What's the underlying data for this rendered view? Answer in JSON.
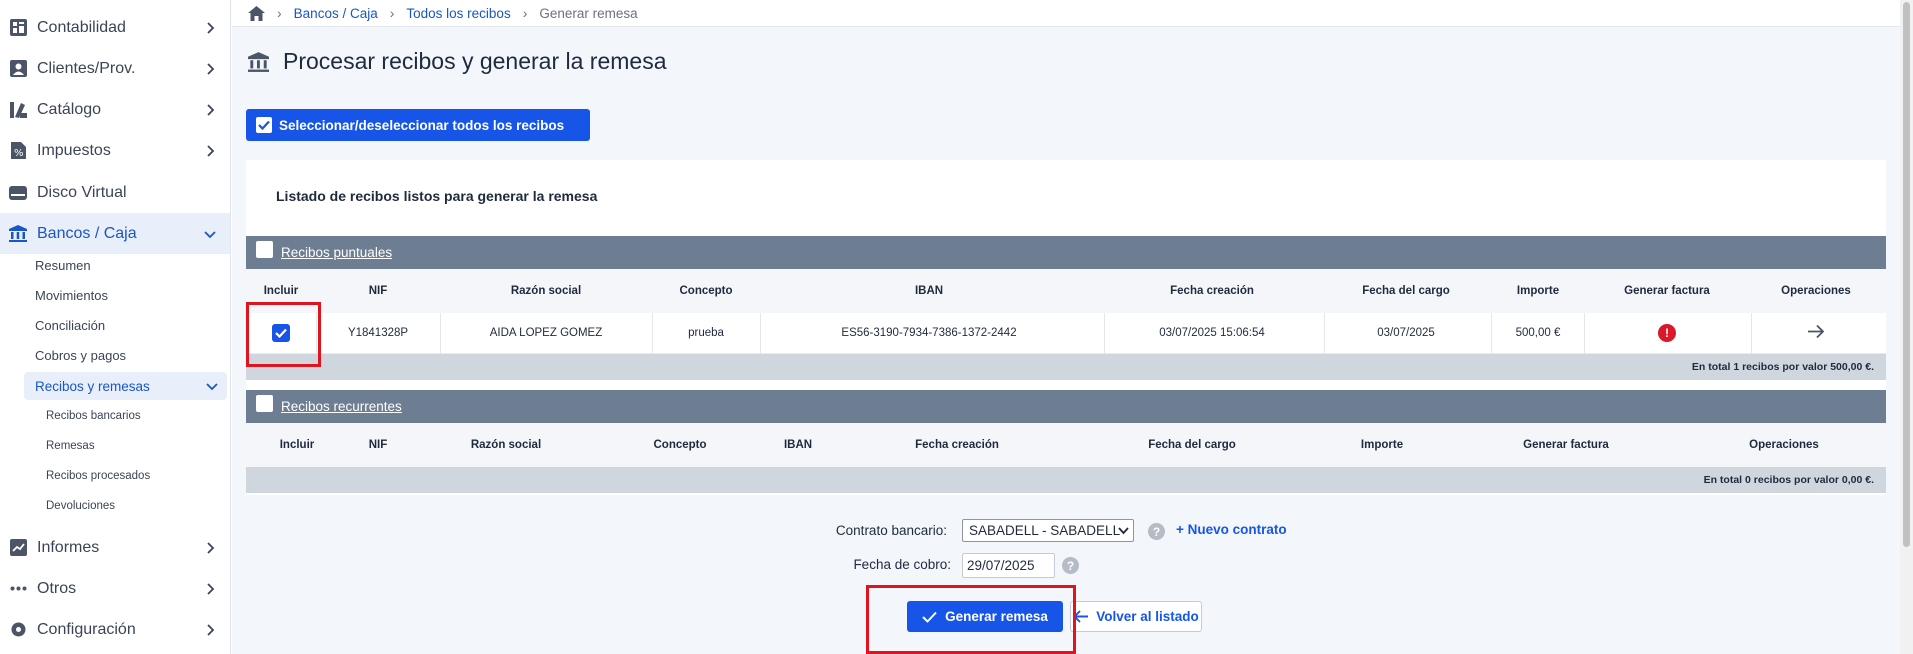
{
  "sidebar": {
    "items": [
      {
        "label": "Contabilidad",
        "icon": "dashboard-icon"
      },
      {
        "label": "Clientes/Prov.",
        "icon": "person-card-icon"
      },
      {
        "label": "Catálogo",
        "icon": "catalog-icon"
      },
      {
        "label": "Impuestos",
        "icon": "tax-icon"
      },
      {
        "label": "Disco Virtual",
        "icon": "disk-icon"
      },
      {
        "label": "Bancos / Caja",
        "icon": "bank-icon"
      },
      {
        "label": "Informes",
        "icon": "report-icon"
      },
      {
        "label": "Otros",
        "icon": "dots-icon"
      },
      {
        "label": "Configuración",
        "icon": "gear-icon"
      }
    ],
    "subitems": [
      "Resumen",
      "Movimientos",
      "Conciliación",
      "Cobros y pagos",
      "Recibos y remesas"
    ],
    "subsubitems": [
      "Recibos bancarios",
      "Remesas",
      "Recibos procesados",
      "Devoluciones"
    ]
  },
  "breadcrumb": {
    "home_icon": "home-icon",
    "items": [
      "Bancos / Caja",
      "Todos los recibos",
      "Generar remesa"
    ]
  },
  "page": {
    "title": "Procesar recibos y generar la remesa",
    "select_all_label": "Seleccionar/deseleccionar todos los recibos"
  },
  "card": {
    "title": "Listado de recibos listos para generar la remesa"
  },
  "puntuales": {
    "section_label": "Recibos puntuales",
    "columns": [
      "Incluir",
      "NIF",
      "Razón social",
      "Concepto",
      "IBAN",
      "Fecha creación",
      "Fecha del cargo",
      "Importe",
      "Generar factura",
      "Operaciones"
    ],
    "rows": [
      {
        "checked": true,
        "nif": "Y1841328P",
        "razon": "AIDA LOPEZ GOMEZ",
        "concepto": "prueba",
        "iban": "ES56-3190-7934-7386-1372-2442",
        "fecha_creacion": "03/07/2025 15:06:54",
        "fecha_cargo": "03/07/2025",
        "importe": "500,00 €",
        "factura_status": "error",
        "operaciones_icon": "arrow-right-icon"
      }
    ],
    "total": "En total 1 recibos por valor 500,00 €."
  },
  "recurrentes": {
    "section_label": "Recibos recurrentes",
    "columns": [
      "Incluir",
      "NIF",
      "Razón social",
      "Concepto",
      "IBAN",
      "Fecha creación",
      "Fecha del cargo",
      "Importe",
      "Generar factura",
      "Operaciones"
    ],
    "total": "En total 0 recibos por valor 0,00 €."
  },
  "form": {
    "contrato_label": "Contrato bancario:",
    "contrato_value": "SABADELL - SABADELL",
    "nuevo_contrato": "+ Nuevo contrato",
    "fecha_label": "Fecha de cobro:",
    "fecha_value": "29/07/2025",
    "help_glyph": "?"
  },
  "actions": {
    "generar": "Generar remesa",
    "volver": "Volver al listado"
  },
  "colors": {
    "primary": "#1655e8",
    "section_bar": "#6d7d92",
    "highlight": "#e0141e",
    "error": "#d9182c"
  }
}
